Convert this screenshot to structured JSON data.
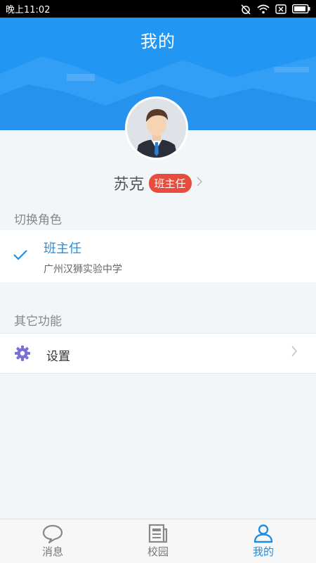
{
  "status_bar": {
    "time": "晚上11:02"
  },
  "header": {
    "title": "我的"
  },
  "profile": {
    "name": "苏克",
    "role_badge": "班主任"
  },
  "switch_role": {
    "section_label": "切换角色",
    "selected_role": {
      "title": "班主任",
      "school": "广州汉狮实验中学"
    }
  },
  "other_features": {
    "section_label": "其它功能",
    "items": [
      {
        "label": "设置",
        "icon": "gear-icon"
      }
    ]
  },
  "tabbar": {
    "items": [
      {
        "label": "消息",
        "icon": "chat-bubble-icon",
        "active": false
      },
      {
        "label": "校园",
        "icon": "newspaper-icon",
        "active": false
      },
      {
        "label": "我的",
        "icon": "person-icon",
        "active": true
      }
    ]
  },
  "colors": {
    "header_blue": "#2196f3",
    "accent_blue": "#1f8fe5",
    "badge_red": "#e74c3c",
    "gear_purple": "#7b6fd8"
  }
}
